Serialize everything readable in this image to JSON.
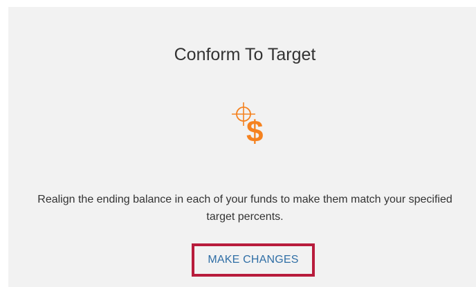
{
  "card": {
    "title": "Conform To Target",
    "icon": "target-dollar-icon",
    "description_line1": "Realign the ending balance in each of your funds to make them match your specified",
    "description_line2": "target percents.",
    "action_label": "MAKE CHANGES"
  },
  "colors": {
    "icon_orange": "#f58220",
    "link_blue": "#2f6ea5",
    "highlight_border": "#b81c3c",
    "card_bg": "#f2f2f2"
  }
}
